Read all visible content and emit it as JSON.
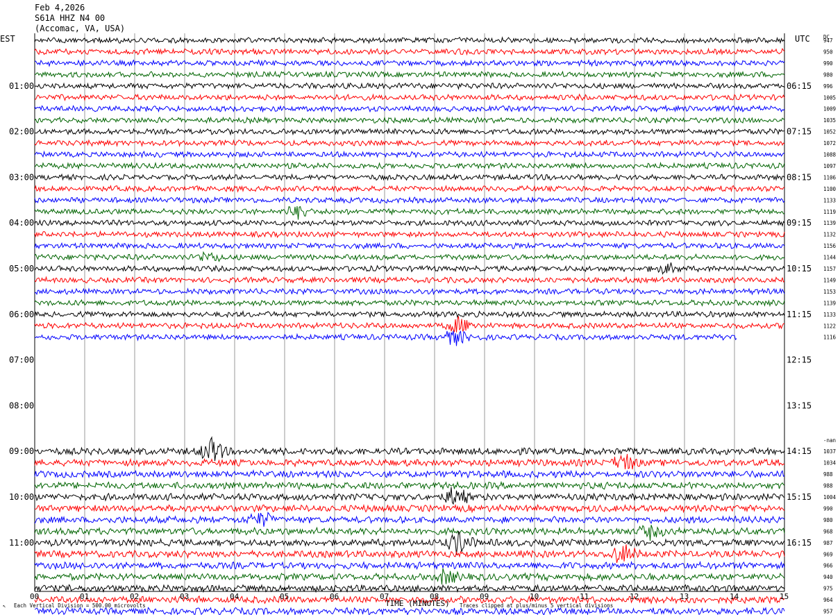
{
  "header": {
    "date": "Feb 4,2026",
    "station": "S61A HHZ N4 00",
    "location": "(Accomac, VA, USA)",
    "left_timezone": "EST",
    "right_timezone": "UTC",
    "dc_label": "DC"
  },
  "footer": {
    "scale_note": "Each Vertical Division =  500.00 microvolts",
    "x_axis_title": "TIME (MINUTES)",
    "clip_note": "Traces clipped at plus/minus 5 vertical divisions"
  },
  "colors": {
    "trace_cycle": [
      "#000000",
      "#ff0000",
      "#0000ff",
      "#006400"
    ],
    "grid": "#7f7f7f",
    "frame": "#000000"
  },
  "chart_data": {
    "type": "line",
    "subtype": "helicorder",
    "x_axis": {
      "label": "TIME (MINUTES)",
      "range": [
        0,
        15
      ],
      "ticks": [
        "00",
        "01",
        "02",
        "03",
        "04",
        "05",
        "06",
        "07",
        "08",
        "09",
        "10",
        "11",
        "12",
        "13",
        "14",
        "15"
      ]
    },
    "left_hour_labels": [
      "01:00",
      "02:00",
      "03:00",
      "04:00",
      "05:00",
      "06:00",
      "07:00",
      "08:00",
      "09:00",
      "10:00",
      "11:00"
    ],
    "right_hour_labels": [
      "06:15",
      "07:15",
      "08:15",
      "09:15",
      "10:15",
      "11:15",
      "12:15",
      "13:15",
      "14:15",
      "15:15",
      "16:15"
    ],
    "row_minutes": 15,
    "rows_per_hour": 4,
    "grid": true,
    "rows": [
      {
        "index": 0,
        "dc": "947",
        "activity": "trace"
      },
      {
        "index": 1,
        "dc": "950",
        "activity": "trace"
      },
      {
        "index": 2,
        "dc": "990",
        "activity": "trace"
      },
      {
        "index": 3,
        "dc": "980",
        "activity": "trace"
      },
      {
        "index": 4,
        "dc": "996",
        "activity": "trace"
      },
      {
        "index": 5,
        "dc": "1005",
        "activity": "trace"
      },
      {
        "index": 6,
        "dc": "1009",
        "activity": "trace"
      },
      {
        "index": 7,
        "dc": "1035",
        "activity": "trace"
      },
      {
        "index": 8,
        "dc": "1052",
        "activity": "trace"
      },
      {
        "index": 9,
        "dc": "1072",
        "activity": "trace"
      },
      {
        "index": 10,
        "dc": "1088",
        "activity": "trace"
      },
      {
        "index": 11,
        "dc": "1097",
        "activity": "trace"
      },
      {
        "index": 12,
        "dc": "1106",
        "activity": "trace"
      },
      {
        "index": 13,
        "dc": "1100",
        "activity": "trace"
      },
      {
        "index": 14,
        "dc": "1133",
        "activity": "trace"
      },
      {
        "index": 15,
        "dc": "1119",
        "activity": "trace"
      },
      {
        "index": 16,
        "dc": "1139",
        "activity": "trace"
      },
      {
        "index": 17,
        "dc": "1132",
        "activity": "trace"
      },
      {
        "index": 18,
        "dc": "1156",
        "activity": "trace"
      },
      {
        "index": 19,
        "dc": "1144",
        "activity": "trace"
      },
      {
        "index": 20,
        "dc": "1157",
        "activity": "trace"
      },
      {
        "index": 21,
        "dc": "1149",
        "activity": "trace"
      },
      {
        "index": 22,
        "dc": "1153",
        "activity": "trace"
      },
      {
        "index": 23,
        "dc": "1139",
        "activity": "trace"
      },
      {
        "index": 24,
        "dc": "1133",
        "activity": "trace"
      },
      {
        "index": 25,
        "dc": "1122",
        "activity": "trace"
      },
      {
        "index": 26,
        "dc": "1116",
        "activity": "trace",
        "end_minute": 14.05
      },
      {
        "index": 27,
        "dc": "",
        "activity": "gap"
      },
      {
        "index": 28,
        "dc": "",
        "activity": "gap"
      },
      {
        "index": 29,
        "dc": "",
        "activity": "gap"
      },
      {
        "index": 30,
        "dc": "",
        "activity": "gap"
      },
      {
        "index": 31,
        "dc": "",
        "activity": "gap"
      },
      {
        "index": 32,
        "dc": "",
        "activity": "gap"
      },
      {
        "index": 33,
        "dc": "",
        "activity": "gap"
      },
      {
        "index": 34,
        "dc": "",
        "activity": "gap"
      },
      {
        "index": 35,
        "dc": "-nan",
        "activity": "gap"
      },
      {
        "index": 36,
        "dc": "1037",
        "activity": "trace"
      },
      {
        "index": 37,
        "dc": "1034",
        "activity": "trace"
      },
      {
        "index": 38,
        "dc": "988",
        "activity": "trace"
      },
      {
        "index": 39,
        "dc": "988",
        "activity": "trace"
      },
      {
        "index": 40,
        "dc": "1004",
        "activity": "trace"
      },
      {
        "index": 41,
        "dc": "990",
        "activity": "trace"
      },
      {
        "index": 42,
        "dc": "980",
        "activity": "trace"
      },
      {
        "index": 43,
        "dc": "968",
        "activity": "trace"
      },
      {
        "index": 44,
        "dc": "987",
        "activity": "trace"
      },
      {
        "index": 45,
        "dc": "969",
        "activity": "trace"
      },
      {
        "index": 46,
        "dc": "966",
        "activity": "trace"
      },
      {
        "index": 47,
        "dc": "940",
        "activity": "trace"
      },
      {
        "index": 48,
        "dc": "975",
        "activity": "trace"
      },
      {
        "index": 49,
        "dc": "964",
        "activity": "trace"
      },
      {
        "index": 50,
        "dc": "957",
        "activity": "trace"
      }
    ],
    "events": [
      {
        "row": 15,
        "minute": 5.3,
        "strength": 1.3
      },
      {
        "row": 19,
        "minute": 3.5,
        "strength": 1.0
      },
      {
        "row": 20,
        "minute": 12.6,
        "strength": 1.2
      },
      {
        "row": 25,
        "minute": 8.5,
        "strength": 2.0
      },
      {
        "row": 26,
        "minute": 8.4,
        "strength": 1.6
      },
      {
        "row": 36,
        "minute": 3.55,
        "strength": 2.0
      },
      {
        "row": 37,
        "minute": 11.8,
        "strength": 1.6
      },
      {
        "row": 40,
        "minute": 8.4,
        "strength": 1.5
      },
      {
        "row": 42,
        "minute": 4.5,
        "strength": 1.3
      },
      {
        "row": 43,
        "minute": 12.3,
        "strength": 1.2
      },
      {
        "row": 44,
        "minute": 8.5,
        "strength": 1.8
      },
      {
        "row": 45,
        "minute": 11.8,
        "strength": 1.8
      },
      {
        "row": 47,
        "minute": 8.2,
        "strength": 1.2
      }
    ]
  }
}
